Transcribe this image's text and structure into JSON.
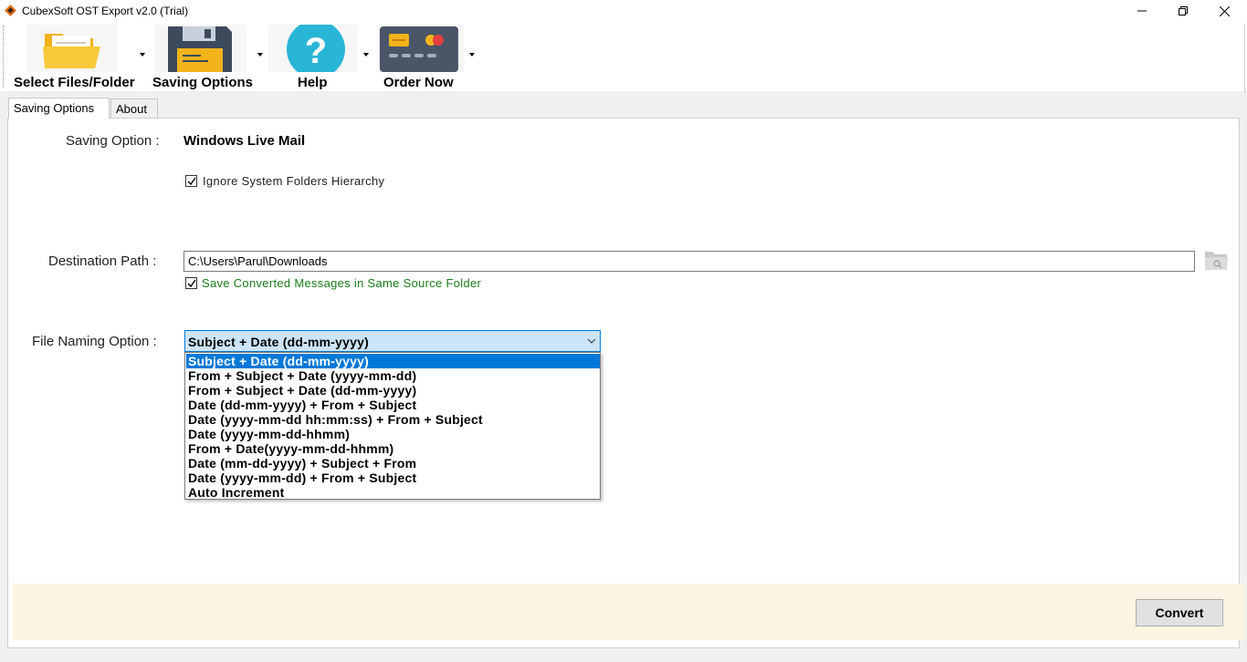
{
  "window": {
    "title": "CubexSoft OST Export v2.0 (Trial)"
  },
  "toolbar": {
    "items": [
      {
        "label": "Select Files/Folder",
        "icon": "folder-icon"
      },
      {
        "label": "Saving Options",
        "icon": "floppy-disk-icon"
      },
      {
        "label": "Help",
        "icon": "help-icon"
      },
      {
        "label": "Order Now",
        "icon": "credit-card-icon"
      }
    ]
  },
  "tabs": [
    {
      "label": "Saving Options",
      "active": true
    },
    {
      "label": "About",
      "active": false
    }
  ],
  "form": {
    "saving_option_label": "Saving Option :",
    "saving_option_value": "Windows Live Mail",
    "ignore_hierarchy_label": "Ignore System Folders Hierarchy",
    "ignore_hierarchy_checked": true,
    "destination_label": "Destination Path :",
    "destination_value": "C:\\Users\\Parul\\Downloads",
    "same_folder_label": "Save Converted Messages in Same Source Folder",
    "same_folder_checked": true,
    "naming_label": "File Naming Option :",
    "naming_selected": "Subject + Date (dd-mm-yyyy)",
    "naming_options": [
      "Subject + Date (dd-mm-yyyy)",
      "From + Subject + Date (yyyy-mm-dd)",
      "From + Subject + Date (dd-mm-yyyy)",
      "Date (dd-mm-yyyy) + From + Subject",
      "Date (yyyy-mm-dd hh:mm:ss) + From + Subject",
      "Date (yyyy-mm-dd-hhmm)",
      "From + Date(yyyy-mm-dd-hhmm)",
      "Date (mm-dd-yyyy) + Subject + From",
      "Date (yyyy-mm-dd) + From + Subject",
      "Auto Increment"
    ]
  },
  "footer": {
    "convert_label": "Convert"
  },
  "colors": {
    "accent": "#0078d7",
    "green_text": "#1a7a1a",
    "footer_bg": "#fcf3e2"
  }
}
